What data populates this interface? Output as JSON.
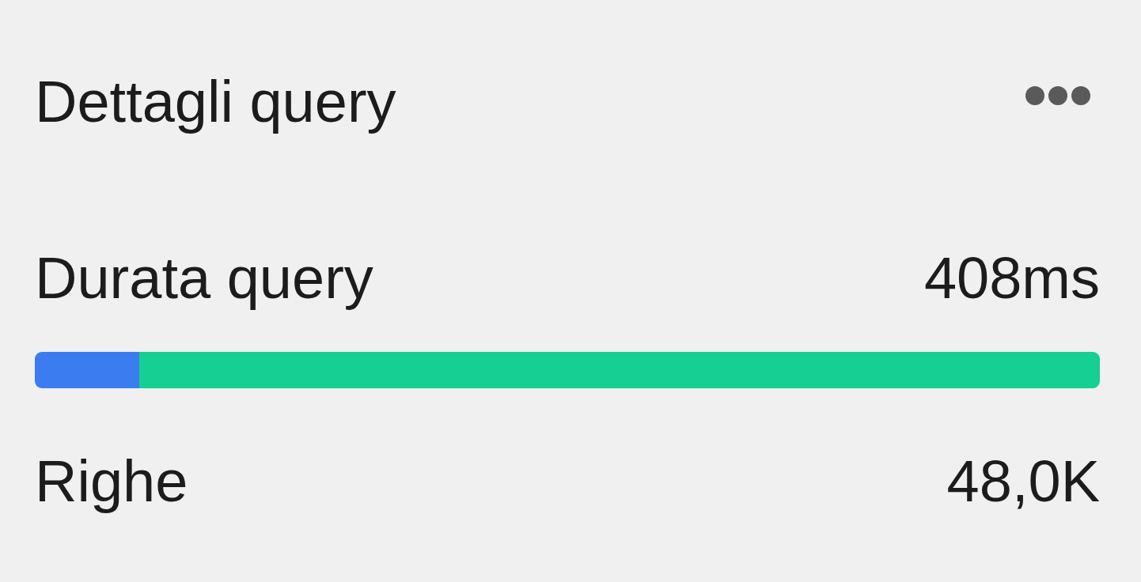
{
  "panel": {
    "title": "Dettagli query"
  },
  "metrics": [
    {
      "kind": "bar",
      "label": "Durata query",
      "value": "408ms",
      "segments": [
        {
          "color": "#3b7cf0",
          "level": 0.098
        },
        {
          "color": "#15d092",
          "level": 0.902
        }
      ]
    },
    {
      "kind": "plain",
      "label": "Righe",
      "value": "48,0K"
    }
  ]
}
